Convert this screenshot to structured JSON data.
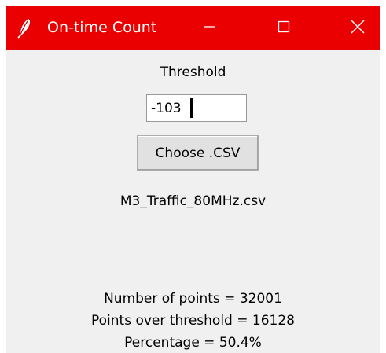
{
  "window": {
    "title": "On-time Count",
    "titlebar_color": "#ea0000",
    "icons": {
      "app": "feather-icon",
      "minimize": "minimize-icon",
      "maximize": "maximize-icon",
      "close": "close-icon"
    }
  },
  "form": {
    "threshold_label": "Threshold",
    "threshold_value": "-103",
    "choose_button_label": "Choose .CSV",
    "selected_file": "M3_Traffic_80MHz.csv"
  },
  "results": {
    "num_points": "Number of points = 32001",
    "points_over_threshold": "Points over threshold = 16128",
    "percentage": "Percentage = 50.4%"
  }
}
